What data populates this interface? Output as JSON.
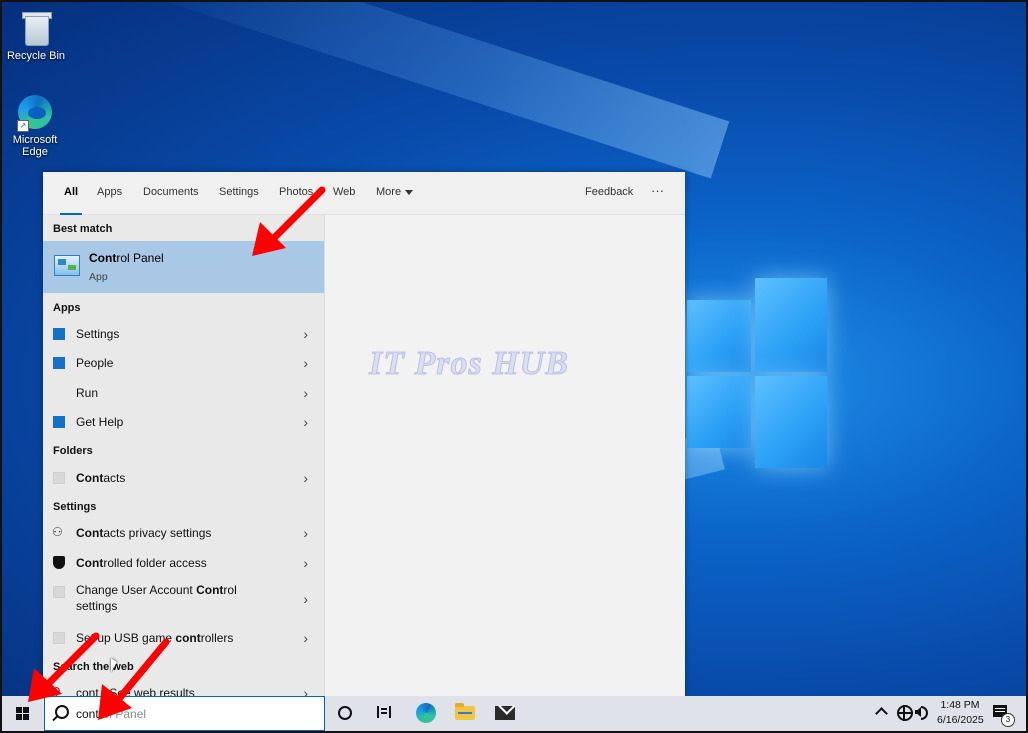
{
  "desktop": {
    "icons": [
      {
        "label": "Recycle Bin",
        "icon": "recycle-bin-icon"
      },
      {
        "label": "Microsoft Edge",
        "icon": "edge-icon"
      }
    ]
  },
  "search_panel": {
    "tabs": [
      "All",
      "Apps",
      "Documents",
      "Settings",
      "Photos",
      "Web",
      "More"
    ],
    "feedback_label": "Feedback",
    "overflow_label": "···",
    "best_match": {
      "header": "Best match",
      "title_bold": "Cont",
      "title_rest": "rol Panel",
      "subtitle": "App"
    },
    "apps": {
      "header": "Apps",
      "items": [
        "Settings",
        "People",
        "Run",
        "Get Help"
      ]
    },
    "folders": {
      "header": "Folders",
      "items": [
        {
          "bold": "Cont",
          "rest": "acts"
        }
      ]
    },
    "settings": {
      "header": "Settings",
      "items": [
        {
          "bold": "Cont",
          "rest": "acts privacy settings"
        },
        {
          "bold": "Cont",
          "rest": "rolled folder access"
        },
        {
          "pre": "Change User Account ",
          "bold": "Cont",
          "rest": "rol settings"
        },
        {
          "pre": "Set up USB game ",
          "bold": "cont",
          "rest": "rollers"
        }
      ]
    },
    "web": {
      "header": "Search the web",
      "item": "cont - See web results"
    },
    "watermark": "IT Pros HUB"
  },
  "taskbar": {
    "search_typed": "cont",
    "search_ghost": "rol Panel",
    "clock_time": "1:48 PM",
    "clock_date": "6/16/2025",
    "notification_count": "3"
  },
  "colors": {
    "accent": "#0067c0",
    "selection": "#a8c8e6",
    "annotation_arrow": "#ff0000"
  }
}
